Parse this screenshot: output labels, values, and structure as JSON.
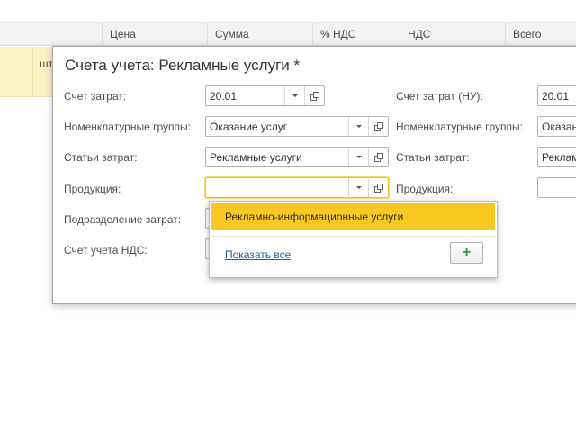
{
  "table": {
    "columns": [
      "Цена",
      "Сумма",
      "% НДС",
      "НДС",
      "Всего"
    ],
    "row_unit": "шт"
  },
  "dialog": {
    "title": "Счета учета: Рекламные услуги *",
    "left": {
      "cost_account_label": "Счет затрат:",
      "cost_account_value": "20.01",
      "nomenclature_groups_label": "Номенклатурные группы:",
      "nomenclature_groups_value": "Оказание услуг",
      "cost_items_label": "Статьи затрат:",
      "cost_items_value": "Рекламные услуги",
      "products_label": "Продукция:",
      "products_value": "",
      "cost_division_label": "Подразделение затрат:",
      "vat_account_label": "Счет учета НДС:"
    },
    "right": {
      "cost_account_nu_label": "Счет затрат (НУ):",
      "cost_account_nu_value": "20.01",
      "nomenclature_groups_label": "Номенклатурные группы:",
      "nomenclature_groups_value": "Оказан",
      "cost_items_label": "Статьи затрат:",
      "cost_items_value": "Реклам",
      "products_label": "Продукция:",
      "products_value": ""
    }
  },
  "popup": {
    "item_label": "Рекламно-информационные услуги",
    "show_all_label": "Показать все",
    "add_button_label": "+"
  },
  "colors": {
    "accent": "#f7c822",
    "link": "#1a5fa8",
    "add_green": "#1c9b3a",
    "selected_row": "#fbf0c6"
  }
}
